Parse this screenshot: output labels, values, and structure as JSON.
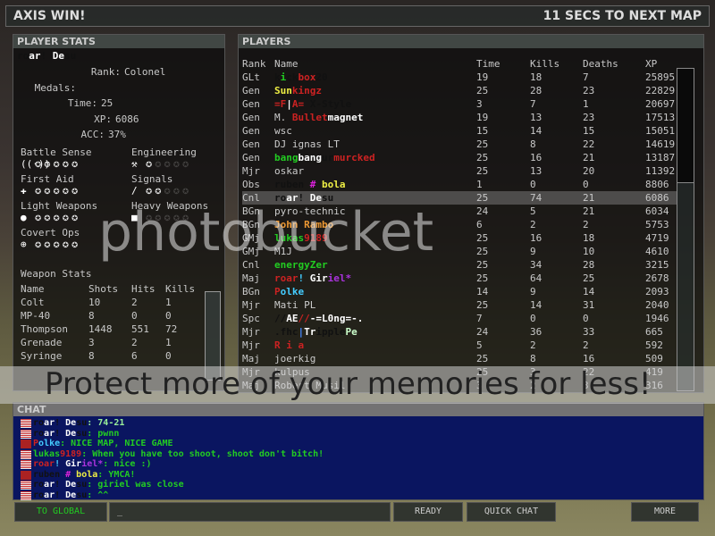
{
  "header": {
    "result": "AXIS WIN!",
    "countdown": "11 SECS TO NEXT MAP"
  },
  "player_stats": {
    "title": "PLAYER STATS",
    "name": [
      {
        "t": "ro",
        "c": "#111"
      },
      {
        "t": "ar",
        "c": "#fff"
      },
      {
        "t": "! ",
        "c": "#111"
      },
      {
        "t": "De",
        "c": "#fff"
      },
      {
        "t": "su",
        "c": "#111"
      }
    ],
    "lines": [
      [
        "Rank:",
        "Colonel"
      ],
      [
        "Medals:",
        ""
      ],
      [
        "Time:",
        "25"
      ],
      [
        "XP:",
        "6086"
      ],
      [
        "ACC:",
        "37%"
      ]
    ],
    "skills": [
      {
        "label": "Battle Sense",
        "icon": "radio-tower-icon",
        "level": 5
      },
      {
        "label": "Engineering",
        "icon": "wrench-icon",
        "level": 1
      },
      {
        "label": "First Aid",
        "icon": "medic-cross-icon",
        "level": 5
      },
      {
        "label": "Signals",
        "icon": "signals-icon",
        "level": 2
      },
      {
        "label": "Light Weapons",
        "icon": "pistol-icon",
        "level": 5
      },
      {
        "label": "Heavy Weapons",
        "icon": "heavy-weapon-icon",
        "level": 0
      },
      {
        "label": "Covert Ops",
        "icon": "crosshair-icon",
        "level": 5
      }
    ],
    "weapon_title": "Weapon Stats",
    "weapon_headers": [
      "Name",
      "Shots",
      "Hits",
      "Kills"
    ],
    "weapons": [
      [
        "Colt",
        "10",
        "2",
        "1"
      ],
      [
        "MP-40",
        "8",
        "0",
        "0"
      ],
      [
        "Thompson",
        "1448",
        "551",
        "72"
      ],
      [
        "Grenade",
        "3",
        "2",
        "1"
      ],
      [
        "Syringe",
        "8",
        "6",
        "0"
      ]
    ]
  },
  "players": {
    "title": "PLAYERS",
    "headers": [
      "Rank",
      "Name",
      "Time",
      "Kills",
      "Deaths",
      "XP"
    ],
    "rows": [
      {
        "rank": "GLt",
        "name": [
          {
            "t": "k",
            "c": "#111"
          },
          {
            "t": "i",
            "c": "#2c2"
          },
          {
            "t": "ck",
            "c": "#111"
          },
          {
            "t": "box",
            "c": "#c22"
          },
          {
            "t": "20",
            "c": "#111"
          }
        ],
        "time": "19",
        "kills": "18",
        "deaths": "7",
        "xp": "25895"
      },
      {
        "rank": "Gen",
        "name": [
          {
            "t": "Sun",
            "c": "#ee4"
          },
          {
            "t": "kingz",
            "c": "#c22"
          }
        ],
        "time": "25",
        "kills": "28",
        "deaths": "23",
        "xp": "22829"
      },
      {
        "rank": "Gen",
        "name": [
          {
            "t": "=F",
            "c": "#c22"
          },
          {
            "t": "|",
            "c": "#fff"
          },
          {
            "t": "A=",
            "c": "#c22"
          },
          {
            "t": " X-Style",
            "c": "#111"
          }
        ],
        "time": "3",
        "kills": "7",
        "deaths": "1",
        "xp": "20697"
      },
      {
        "rank": "Gen",
        "name": [
          {
            "t": "M. ",
            "c": "#ccc"
          },
          {
            "t": "Bullet",
            "c": "#c22"
          },
          {
            "t": "magnet",
            "c": "#fff"
          }
        ],
        "time": "19",
        "kills": "13",
        "deaths": "23",
        "xp": "17513"
      },
      {
        "rank": "Gen",
        "name": [
          {
            "t": "wsc",
            "c": "#ccc"
          }
        ],
        "time": "15",
        "kills": "14",
        "deaths": "15",
        "xp": "15051"
      },
      {
        "rank": "Gen",
        "name": [
          {
            "t": "DJ ignas LT",
            "c": "#ccc"
          }
        ],
        "time": "25",
        "kills": "8",
        "deaths": "22",
        "xp": "14619"
      },
      {
        "rank": "Gen",
        "name": [
          {
            "t": "bang",
            "c": "#2c2"
          },
          {
            "t": "bang",
            "c": "#fff"
          },
          {
            "t": "ur",
            "c": "#111"
          },
          {
            "t": "murcked",
            "c": "#c22"
          }
        ],
        "time": "25",
        "kills": "16",
        "deaths": "21",
        "xp": "13187"
      },
      {
        "rank": "Mjr",
        "name": [
          {
            "t": "oskar",
            "c": "#ccc"
          }
        ],
        "time": "25",
        "kills": "13",
        "deaths": "20",
        "xp": "11392"
      },
      {
        "rank": "Obs",
        "name": [
          {
            "t": "ruben ",
            "c": "#111"
          },
          {
            "t": "# ",
            "c": "#d2d"
          },
          {
            "t": "bola",
            "c": "#ee4"
          }
        ],
        "time": "1",
        "kills": "0",
        "deaths": "0",
        "xp": "8806"
      },
      {
        "rank": "Cnl",
        "name": [
          {
            "t": "ro",
            "c": "#111"
          },
          {
            "t": "ar",
            "c": "#fff"
          },
          {
            "t": "! ",
            "c": "#111"
          },
          {
            "t": "De",
            "c": "#fff"
          },
          {
            "t": "su",
            "c": "#111"
          }
        ],
        "time": "25",
        "kills": "74",
        "deaths": "21",
        "xp": "6086",
        "highlight": true
      },
      {
        "rank": "BGn",
        "name": [
          {
            "t": "pyro-technic",
            "c": "#ccc"
          }
        ],
        "time": "24",
        "kills": "5",
        "deaths": "21",
        "xp": "6034"
      },
      {
        "rank": "BGn",
        "name": [
          {
            "t": "John Rambo",
            "c": "#e93"
          }
        ],
        "time": "6",
        "kills": "2",
        "deaths": "2",
        "xp": "5753"
      },
      {
        "rank": "GMj",
        "name": [
          {
            "t": "lukas",
            "c": "#2c2"
          },
          {
            "t": "9189",
            "c": "#c22"
          }
        ],
        "time": "25",
        "kills": "16",
        "deaths": "18",
        "xp": "4719"
      },
      {
        "rank": "GMj",
        "name": [
          {
            "t": "M1J",
            "c": "#ccc"
          }
        ],
        "time": "25",
        "kills": "9",
        "deaths": "10",
        "xp": "4610"
      },
      {
        "rank": "Cnl",
        "name": [
          {
            "t": "energyZer",
            "c": "#2c2"
          }
        ],
        "time": "25",
        "kills": "34",
        "deaths": "28",
        "xp": "3215"
      },
      {
        "rank": "Maj",
        "name": [
          {
            "t": "roar",
            "c": "#c22"
          },
          {
            "t": "! ",
            "c": "#4cf"
          },
          {
            "t": "Gir",
            "c": "#fff"
          },
          {
            "t": "iel*",
            "c": "#a3d"
          }
        ],
        "time": "25",
        "kills": "64",
        "deaths": "25",
        "xp": "2678"
      },
      {
        "rank": "BGn",
        "name": [
          {
            "t": "P",
            "c": "#c22"
          },
          {
            "t": "olke",
            "c": "#4cf"
          }
        ],
        "time": "14",
        "kills": "9",
        "deaths": "14",
        "xp": "2093"
      },
      {
        "rank": "Mjr",
        "name": [
          {
            "t": "Mati PL",
            "c": "#ccc"
          }
        ],
        "time": "25",
        "kills": "14",
        "deaths": "31",
        "xp": "2040"
      },
      {
        "rank": "Spc",
        "name": [
          {
            "t": "//",
            "c": "#111"
          },
          {
            "t": "AE",
            "c": "#fff"
          },
          {
            "t": "//",
            "c": "#c22"
          },
          {
            "t": "-=L0ng=-.",
            "c": "#fff"
          }
        ],
        "time": "7",
        "kills": "0",
        "deaths": "0",
        "xp": "1946"
      },
      {
        "rank": "Mjr",
        "name": [
          {
            "t": ".fhc",
            "c": "#111"
          },
          {
            "t": "|",
            "c": "#48f"
          },
          {
            "t": "Tr",
            "c": "#fff"
          },
          {
            "t": "ipple",
            "c": "#111"
          },
          {
            "t": "Pe",
            "c": "#cfc"
          }
        ],
        "time": "24",
        "kills": "36",
        "deaths": "33",
        "xp": "665"
      },
      {
        "rank": "Mjr",
        "name": [
          {
            "t": "R i a",
            "c": "#c22"
          }
        ],
        "time": "5",
        "kills": "2",
        "deaths": "2",
        "xp": "592"
      },
      {
        "rank": "Maj",
        "name": [
          {
            "t": "joerkig",
            "c": "#ccc"
          }
        ],
        "time": "25",
        "kills": "8",
        "deaths": "16",
        "xp": "509"
      },
      {
        "rank": "Mjr",
        "name": [
          {
            "t": "kulpus",
            "c": "#ccc"
          }
        ],
        "time": "25",
        "kills": "3",
        "deaths": "22",
        "xp": "419"
      },
      {
        "rank": "Maj",
        "name": [
          {
            "t": "Robert Musil",
            "c": "#ccc"
          }
        ],
        "time": "3",
        "kills": "2",
        "deaths": "3",
        "xp": "316"
      }
    ]
  },
  "chat": {
    "title": "CHAT",
    "messages": [
      {
        "team": "allies",
        "name": [
          {
            "t": "ro",
            "c": "#111"
          },
          {
            "t": "ar",
            "c": "#fff"
          },
          {
            "t": "! ",
            "c": "#111"
          },
          {
            "t": "De",
            "c": "#fff"
          },
          {
            "t": "su",
            "c": "#111"
          }
        ],
        "text": ": 74-21",
        "color": "#9e9"
      },
      {
        "team": "allies",
        "name": [
          {
            "t": "ro",
            "c": "#111"
          },
          {
            "t": "ar",
            "c": "#fff"
          },
          {
            "t": "! ",
            "c": "#111"
          },
          {
            "t": "De",
            "c": "#fff"
          },
          {
            "t": "su",
            "c": "#111"
          }
        ],
        "text": ": pwnn",
        "color": "#2c2"
      },
      {
        "team": "axis",
        "name": [
          {
            "t": "P",
            "c": "#c22"
          },
          {
            "t": "olke",
            "c": "#4cf"
          }
        ],
        "text": ": NICE MAP, NICE GAME",
        "color": "#2c2"
      },
      {
        "team": "allies",
        "name": [
          {
            "t": "lukas",
            "c": "#2c2"
          },
          {
            "t": "9189",
            "c": "#c22"
          }
        ],
        "text": ": When you have too shoot, shoot don't bitch!",
        "color": "#2c2"
      },
      {
        "team": "allies",
        "name": [
          {
            "t": "roar",
            "c": "#c22"
          },
          {
            "t": "! ",
            "c": "#4cf"
          },
          {
            "t": "Gir",
            "c": "#fff"
          },
          {
            "t": "iel*",
            "c": "#a3d"
          }
        ],
        "text": ": nice :)",
        "color": "#2c2"
      },
      {
        "team": "axis",
        "name": [
          {
            "t": "ruben ",
            "c": "#111"
          },
          {
            "t": "# ",
            "c": "#d2d"
          },
          {
            "t": "bola",
            "c": "#ee4"
          }
        ],
        "text": ": YMCA!",
        "color": "#2c2"
      },
      {
        "team": "allies",
        "name": [
          {
            "t": "ro",
            "c": "#111"
          },
          {
            "t": "ar",
            "c": "#fff"
          },
          {
            "t": "! ",
            "c": "#111"
          },
          {
            "t": "De",
            "c": "#fff"
          },
          {
            "t": "su",
            "c": "#111"
          }
        ],
        "text": ": giriel was close",
        "color": "#2c2"
      },
      {
        "team": "allies",
        "name": [
          {
            "t": "ro",
            "c": "#111"
          },
          {
            "t": "ar",
            "c": "#fff"
          },
          {
            "t": "! ",
            "c": "#111"
          },
          {
            "t": "De",
            "c": "#fff"
          },
          {
            "t": "su",
            "c": "#111"
          }
        ],
        "text": ": ^^",
        "color": "#2c2"
      }
    ],
    "input_value": "_"
  },
  "buttons": {
    "to_global": "TO GLOBAL",
    "ready": "READY",
    "quick_chat": "QUICK CHAT",
    "more": "MORE"
  },
  "watermark": {
    "logo": "photobucket",
    "slogan": "Protect more of your memories for less!"
  }
}
